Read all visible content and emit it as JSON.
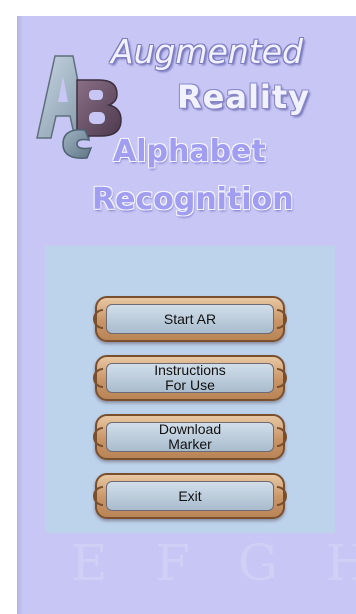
{
  "title": {
    "line1": "Augmented",
    "line2": "Reality",
    "line3": "Alphabet",
    "line4": "Recognition"
  },
  "logo": {
    "name": "abc-logo",
    "letters": [
      "A",
      "B",
      "C"
    ]
  },
  "menu": {
    "start_label": "Start AR",
    "instructions_label_line1": "Instructions",
    "instructions_label_line2": "For Use",
    "download_label_line1": "Download",
    "download_label_line2": "Marker",
    "exit_label": "Exit"
  },
  "watermark": "E F G H",
  "colors": {
    "background": "#c7c6f4",
    "panel": "#bdd3ec",
    "button_frame": "#c99567",
    "title_purple": "#a19df0"
  }
}
